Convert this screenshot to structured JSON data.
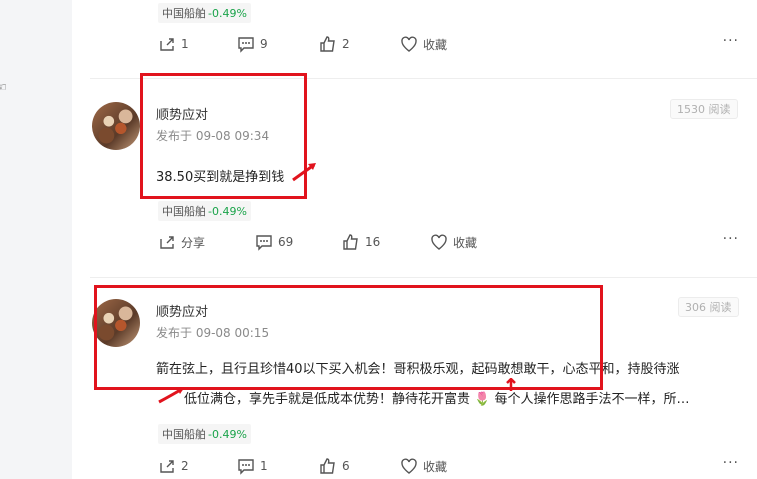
{
  "posts": [
    {
      "stock": {
        "name": "中国船舶",
        "change": "-0.49%"
      },
      "actions": {
        "share": "1",
        "comments": "9",
        "likes": "2",
        "fav": "收藏"
      }
    },
    {
      "author": "顺势应对",
      "time": "发布于 09-08 09:34",
      "views": "1530 阅读",
      "content": "38.50买到就是挣到钱",
      "stock": {
        "name": "中国船舶",
        "change": "-0.49%"
      },
      "actions": {
        "share": "分享",
        "comments": "69",
        "likes": "16",
        "fav": "收藏"
      }
    },
    {
      "author": "顺势应对",
      "time": "发布于 09-08 00:15",
      "views": "306 阅读",
      "content_line1": "箭在弦上，且行且珍惜40以下买入机会！哥积极乐观，起码敢想敢干，心态平和，持股待涨",
      "content_line2": "低位满仓，享先手就是低成本优势！静待花开富贵 🌷 每个人操作思路手法不一样，所…",
      "stock": {
        "name": "中国船舶",
        "change": "-0.49%"
      },
      "actions": {
        "share": "2",
        "comments": "1",
        "likes": "6",
        "fav": "收藏"
      }
    }
  ],
  "colors": {
    "highlight": "#e1131d",
    "down": "#1aa34a"
  }
}
